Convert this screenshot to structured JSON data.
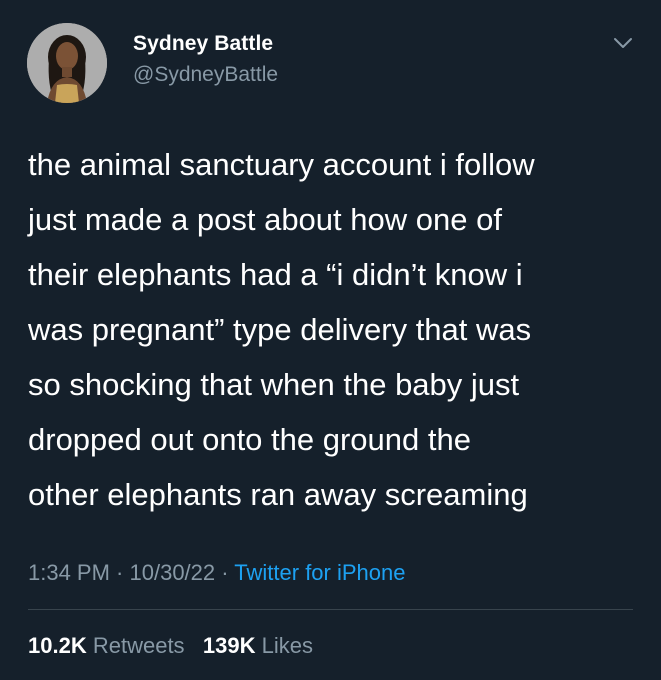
{
  "user": {
    "display_name": "Sydney Battle",
    "handle": "@SydneyBattle",
    "avatar_icon": "profile-photo"
  },
  "tweet": {
    "text_lines": [
      "the animal sanctuary account i follow",
      "just made a post about how one of",
      "their elephants had a “i didn’t know i",
      "was pregnant” type delivery that was",
      "so shocking that when the baby just",
      "dropped out onto the ground the",
      "other elephants ran away screaming"
    ]
  },
  "meta": {
    "time": "1:34 PM",
    "separator": " · ",
    "date": "10/30/22",
    "source": "Twitter for iPhone"
  },
  "stats": {
    "retweets_count": "10.2K",
    "retweets_label": "Retweets",
    "likes_count": "139K",
    "likes_label": "Likes"
  },
  "colors": {
    "background": "#15202b",
    "text": "#ffffff",
    "secondary": "#8899a6",
    "link": "#1da1f2",
    "divider": "#38444d"
  },
  "icons": {
    "menu": "chevron-down-icon"
  }
}
